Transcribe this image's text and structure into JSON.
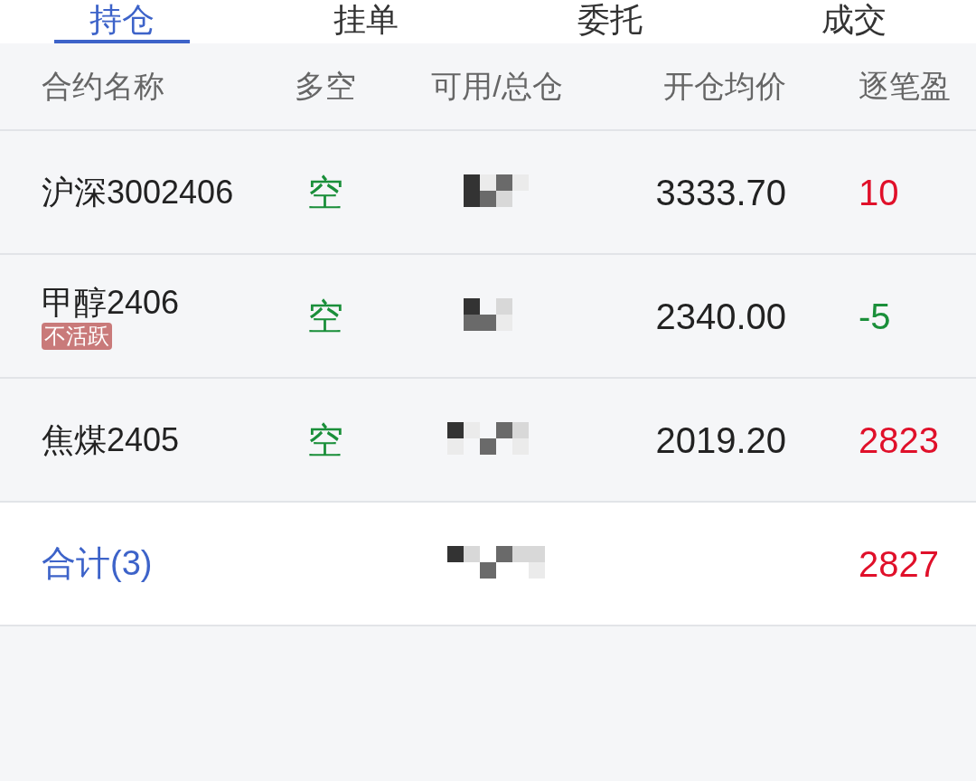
{
  "tabs": [
    {
      "label": "持仓",
      "selected": true
    },
    {
      "label": "挂单",
      "selected": false
    },
    {
      "label": "委托",
      "selected": false
    },
    {
      "label": "成交",
      "selected": false
    }
  ],
  "table": {
    "columns": [
      "合约名称",
      "多空",
      "可用/总仓",
      "开仓均价",
      "逐笔盈"
    ],
    "rows": [
      {
        "name": "沪深3002406",
        "side": {
          "text": "空",
          "color": "#1a8f3a"
        },
        "avg_price": "3333.70",
        "pnl": {
          "text": "10",
          "color": "#e0102a"
        }
      },
      {
        "name": "甲醇2406",
        "tag": "不活跃",
        "side": {
          "text": "空",
          "color": "#1a8f3a"
        },
        "avg_price": "2340.00",
        "pnl": {
          "text": "-5",
          "color": "#1a8f3a"
        }
      },
      {
        "name": "焦煤2405",
        "side": {
          "text": "空",
          "color": "#1a8f3a"
        },
        "avg_price": "2019.20",
        "pnl": {
          "text": "2823",
          "color": "#e0102a"
        }
      }
    ],
    "total": {
      "label": "合计(3)",
      "pnl": {
        "text": "2827",
        "color": "#e0102a"
      }
    }
  }
}
